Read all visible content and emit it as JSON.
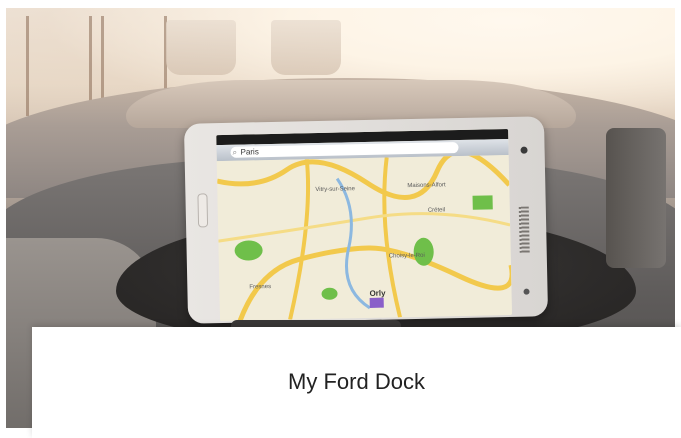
{
  "caption": {
    "title": "My Ford Dock"
  },
  "phone": {
    "search_text": "Paris",
    "map_labels": [
      "Vitry-sur-Seine",
      "Maisons-Alfort",
      "Créteil",
      "Orly",
      "Fresnes",
      "Choisy-le-Roi"
    ],
    "map_city_label": "Orly"
  },
  "colors": {
    "caption_bg": "#ffffff",
    "caption_text": "#222222",
    "map_road_yellow": "#f2c94c",
    "map_park_green": "#6fbf4a",
    "map_water_blue": "#8cb8e0"
  },
  "icons": [
    "search-icon",
    "bookmark-icon",
    "location-icon"
  ]
}
